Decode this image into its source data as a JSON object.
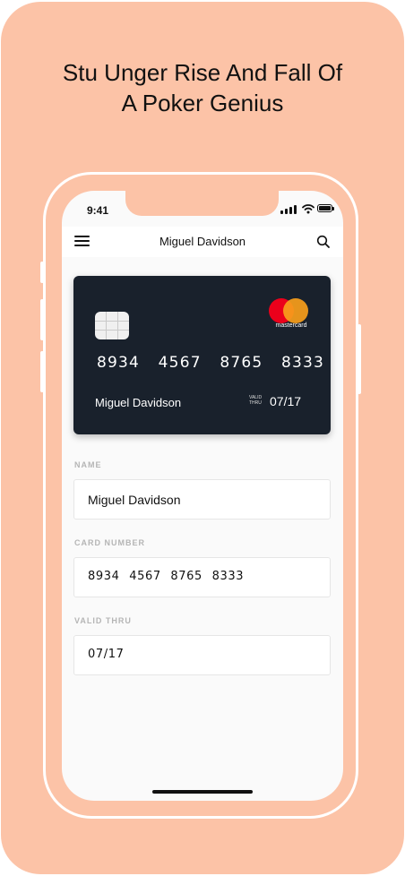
{
  "headline": {
    "line1": "Stu Unger Rise And Fall Of",
    "line2": "A Poker Genius"
  },
  "status_bar": {
    "time": "9:41"
  },
  "topbar": {
    "title": "Miguel Davidson"
  },
  "card": {
    "brand": "mastercard",
    "number": "8934 4567 8765 8333",
    "holder": "Miguel Davidson",
    "valid_label_line1": "VALID",
    "valid_label_line2": "THRU",
    "expiry": "07/17"
  },
  "form": {
    "name_label": "NAME",
    "name_value": "Miguel Davidson",
    "card_number_label": "CARD NUMBER",
    "card_number_value": "8934  4567  8765  8333",
    "valid_thru_label": "VALID THRU",
    "valid_thru_value": "07/17"
  },
  "colors": {
    "background": "#fcc3a7",
    "card": "#19212c",
    "mastercard_red": "#eb001b",
    "mastercard_orange": "#f79e1b"
  },
  "icons": [
    "menu-icon",
    "search-icon",
    "signal-icon",
    "wifi-icon",
    "battery-icon",
    "chip-icon",
    "mastercard-logo"
  ]
}
